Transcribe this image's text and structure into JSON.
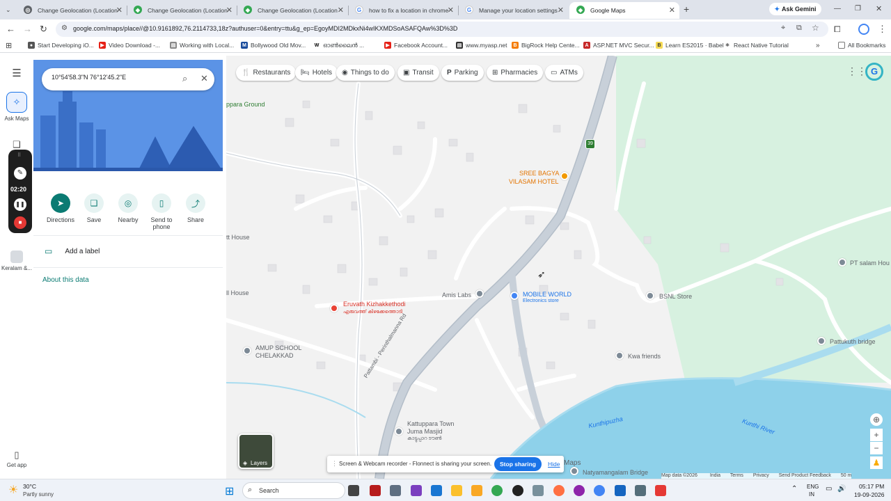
{
  "tabs": [
    {
      "title": "Change Geolocation (Location",
      "active": false
    },
    {
      "title": "Change Geolocation (Location",
      "active": false
    },
    {
      "title": "Change Geolocation (Location",
      "active": false
    },
    {
      "title": "how to fix a location in chrome",
      "active": false
    },
    {
      "title": "Manage your location settings",
      "active": false
    },
    {
      "title": "Google Maps",
      "active": true
    }
  ],
  "ask_gemini": "Ask Gemini",
  "url": "google.com/maps/place//@10.9161892,76.2114733,18z?authuser=0&entry=ttu&g_ep=EgoyMDI2MDkxNi4wIKXMDSoASAFQAw%3D%3D",
  "bookmarks": [
    "Start Developing iO...",
    "Video Download -...",
    "Working with Local...",
    "Bollywood Old Mov...",
    "ഓൺലൈൻ ...",
    "Facebook Account...",
    "www.myasp.net",
    "BigRock Help Cente...",
    "ASP.NET MVC Secur...",
    "Learn ES2015 · Babel",
    "React Native Tutorial"
  ],
  "all_bookmarks": "All Bookmarks",
  "rail": {
    "ask_maps": "Ask Maps",
    "saved": "Keralam &...",
    "get_app": "Get app"
  },
  "recorder": {
    "time": "02:20"
  },
  "search": {
    "value": "10°54'58.3\"N 76°12'45.2\"E"
  },
  "actions": [
    {
      "label": "Directions"
    },
    {
      "label": "Save"
    },
    {
      "label": "Nearby"
    },
    {
      "label": "Send to phone"
    },
    {
      "label": "Share"
    }
  ],
  "add_label": "Add a label",
  "about": "About this data",
  "chips": [
    "Restaurants",
    "Hotels",
    "Things to do",
    "Transit",
    "Parking",
    "Pharmacies",
    "ATMs"
  ],
  "map_labels": {
    "ground": "ppara Ground",
    "hotel_1": "SREE BAGYA",
    "hotel_2": "VILASAM HOTEL",
    "house_1": "tt House",
    "house_2": "ll House",
    "amis": "Amis Labs",
    "mobile_world": "MOBILE WORLD",
    "electronics": "Electronics store",
    "bsnl": "BSNL Store",
    "pt_salam": "PT salam Hou",
    "eruvath": "Eruvath Kizhakkethodi",
    "eruvath_ml": "എരുവത്ത് കിഴക്കേത്തൊടി",
    "amup_1": "AMUP SCHOOL",
    "amup_2": "CHELAKKAD",
    "kwa": "Kwa friends",
    "pattukuth": "Pattukuth bridge",
    "road": "Pattambi - Perinthalmanna Rd",
    "river_1": "Kunthipuzha",
    "river_2": "Kunthi River",
    "masjid_1": "Kattuppara Town",
    "masjid_2": "Juma Masjid",
    "masjid_ml": "കാട്ടുപ്പാറ ടൗൺ",
    "bridge": "Natyamangalam Bridge",
    "route_badge": "39"
  },
  "layers": "Layers",
  "flonnect": {
    "text": "Screen & Webcam recorder - Flonnect is sharing your screen.",
    "stop": "Stop sharing",
    "hide": "Hide"
  },
  "maps_brand": "Maps",
  "footer": [
    "Map data ©2026",
    "India",
    "Terms",
    "Privacy",
    "Send Product Feedback",
    "50 m"
  ],
  "taskbar": {
    "temp": "30°C",
    "weather": "Partly sunny",
    "search": "Search",
    "lang_1": "ENG",
    "lang_2": "IN",
    "time": "05:17 PM",
    "date": "19-09-2026"
  }
}
